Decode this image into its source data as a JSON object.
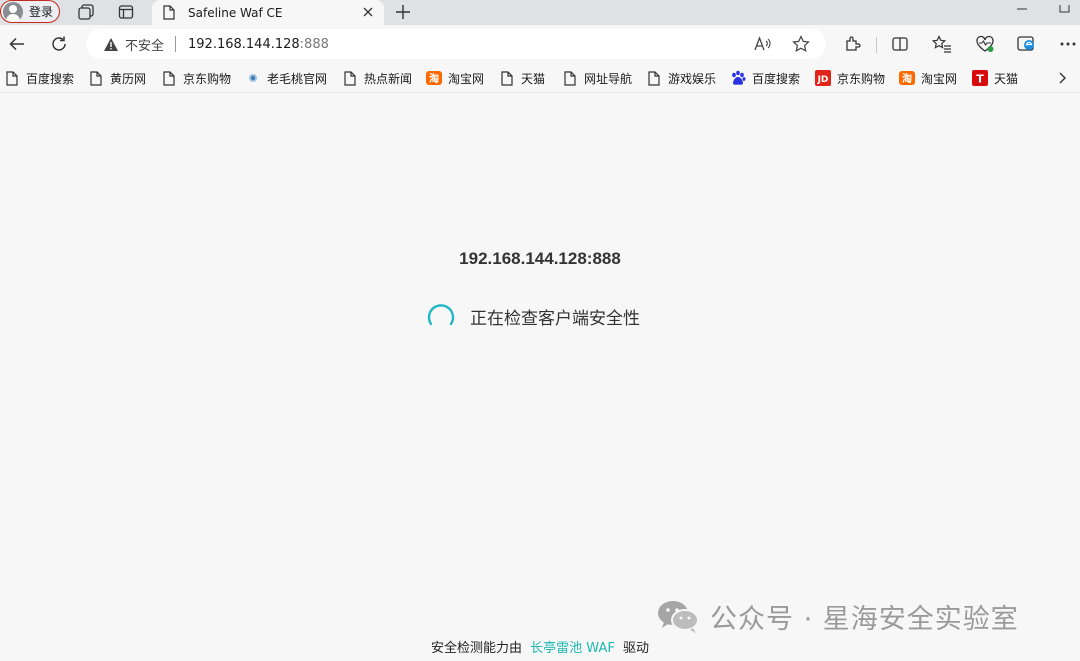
{
  "browser": {
    "profile_label": "登录",
    "tab": {
      "title": "Safeline Waf CE"
    },
    "address_bar": {
      "security_label": "不安全",
      "url_host": "192.168.144.128",
      "url_port": ":888"
    },
    "bookmarks": [
      {
        "label": "百度搜索",
        "icon": "page-icon"
      },
      {
        "label": "黄历网",
        "icon": "page-icon"
      },
      {
        "label": "京东购物",
        "icon": "page-icon"
      },
      {
        "label": "老毛桃官网",
        "icon": "globe-dot-icon"
      },
      {
        "label": "热点新闻",
        "icon": "page-icon"
      },
      {
        "label": "淘宝网",
        "icon": "taobao-icon"
      },
      {
        "label": "天猫",
        "icon": "page-icon"
      },
      {
        "label": "网址导航",
        "icon": "page-icon"
      },
      {
        "label": "游戏娱乐",
        "icon": "page-icon"
      },
      {
        "label": "百度搜索",
        "icon": "baidu-paw-icon"
      },
      {
        "label": "京东购物",
        "icon": "jd-icon"
      },
      {
        "label": "淘宝网",
        "icon": "taobao-icon"
      },
      {
        "label": "天猫",
        "icon": "tmall-icon"
      }
    ]
  },
  "page": {
    "host": "192.168.144.128:888",
    "status_text": "正在检查客户端安全性",
    "footer": {
      "prefix": "安全检测能力由",
      "brand": "长亭雷池 WAF",
      "suffix": "驱动"
    },
    "watermark": "公众号 · 星海安全实验室"
  },
  "colors": {
    "accent": "#1fb8b0",
    "spinner": "#22b7c4",
    "profile_border": "#c42b1c"
  }
}
